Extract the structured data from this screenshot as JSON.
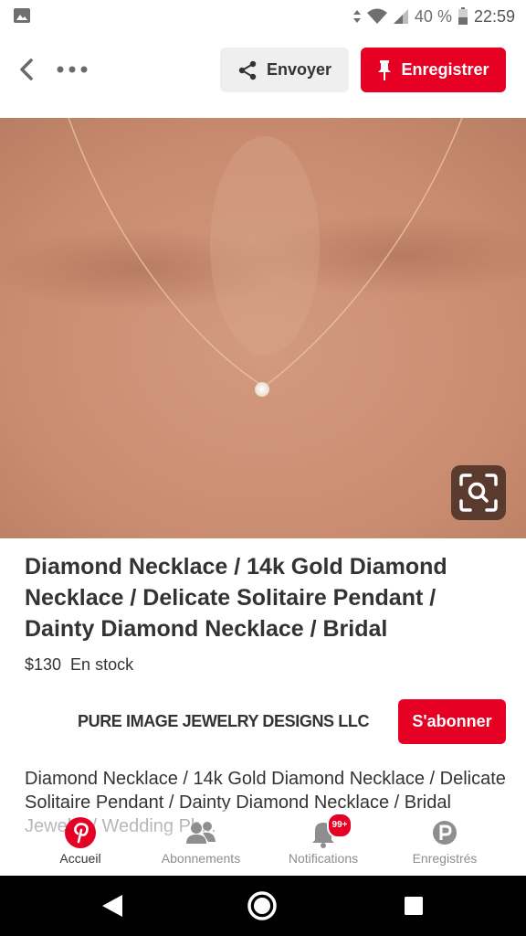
{
  "status_bar": {
    "battery_percent": "40 %",
    "time": "22:59"
  },
  "toolbar": {
    "send_label": "Envoyer",
    "save_label": "Enregistrer"
  },
  "product": {
    "title": "Diamond Necklace / 14k Gold Diamond Necklace / Delicate Solitaire Pendant / Dainty Diamond Necklace / Bridal",
    "price": "$130",
    "stock": "En stock",
    "store_name": "PURE IMAGE JEWELRY DESIGNS LLC",
    "subscribe_label": "S'abonner",
    "description": "Diamond Necklace / 14k Gold Diamond Necklace / Delicate Solitaire Pendant / Dainty Diamond Necklace / Bridal Jewelry / Wedding Ph..."
  },
  "tabs": [
    {
      "label": "Accueil",
      "icon": "pinterest-logo-icon",
      "active": true
    },
    {
      "label": "Abonnements",
      "icon": "people-icon",
      "active": false
    },
    {
      "label": "Notifications",
      "icon": "bell-icon",
      "badge": "99+",
      "active": false
    },
    {
      "label": "Enregistrés",
      "icon": "profile-p-icon",
      "active": false
    }
  ],
  "colors": {
    "brand_red": "#e60023",
    "text": "#333333",
    "muted": "#8e8e8e"
  }
}
